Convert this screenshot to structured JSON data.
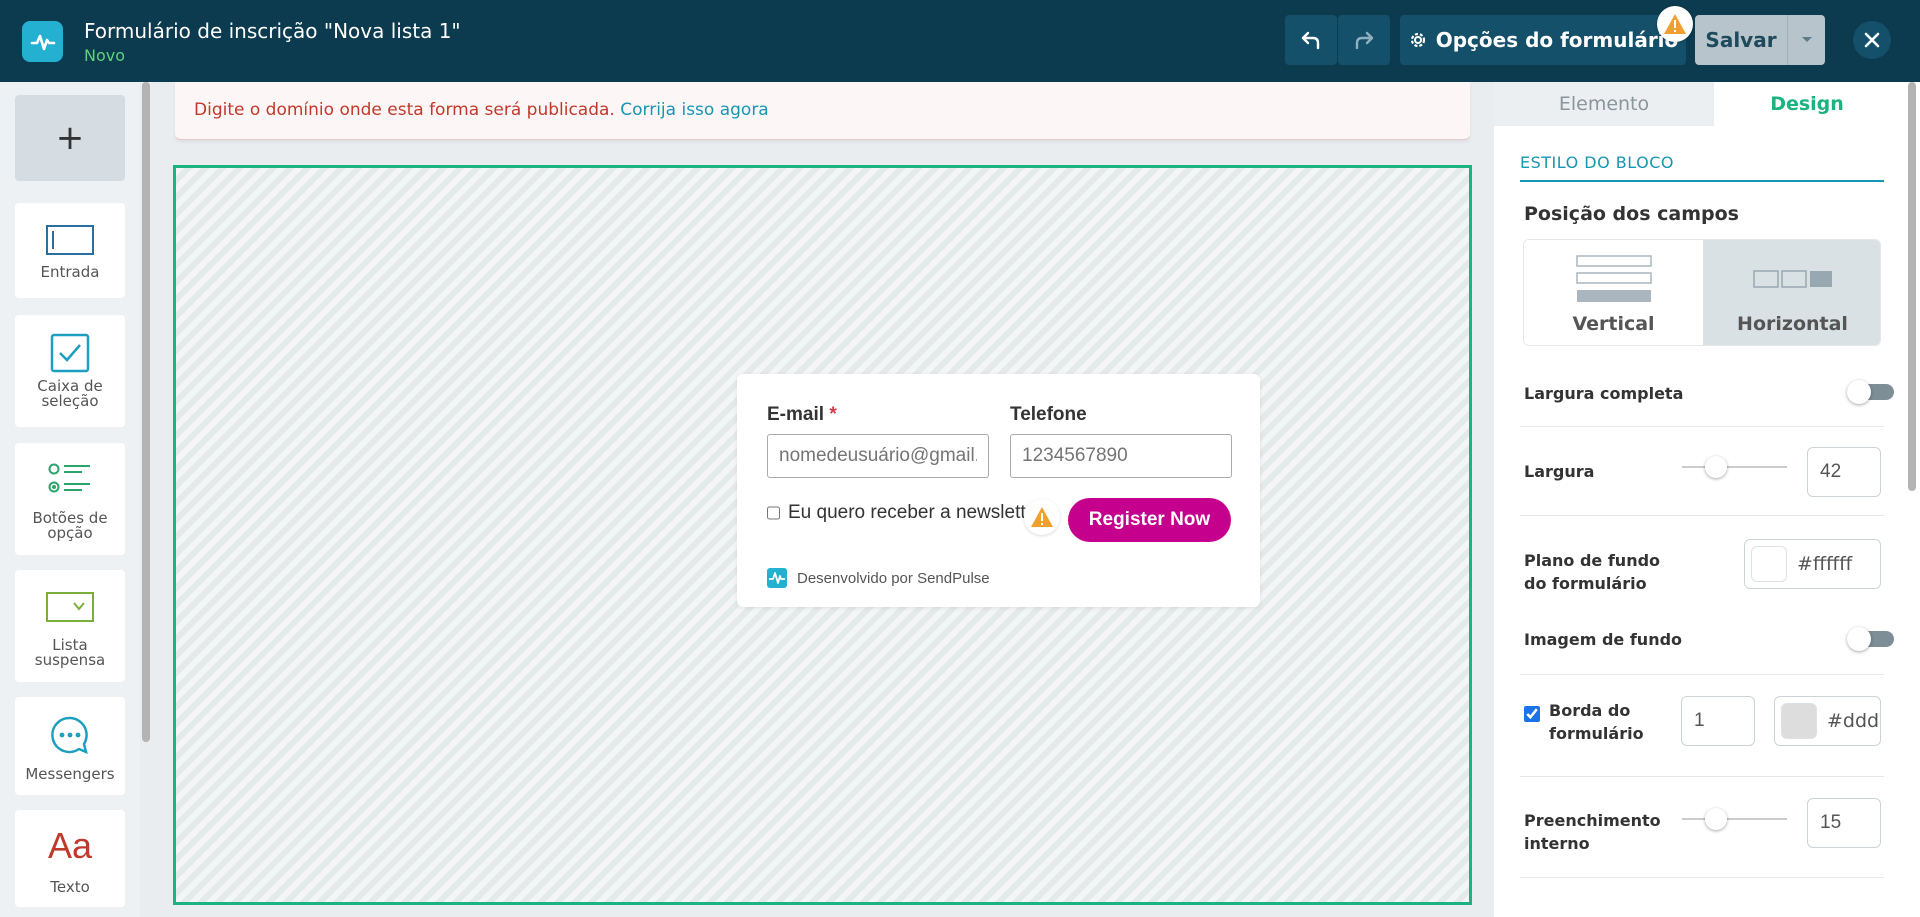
{
  "header": {
    "title": "Formulário de inscrição \"Nova lista 1\"",
    "status": "Novo",
    "options_label": "Opções do formulário",
    "save_label": "Salvar"
  },
  "palette": {
    "items": [
      {
        "label": "Entrada"
      },
      {
        "label": "Caixa de seleção"
      },
      {
        "label": "Botões de opção"
      },
      {
        "label": "Lista suspensa"
      },
      {
        "label": "Messengers"
      },
      {
        "label": "Texto"
      }
    ]
  },
  "alert": {
    "text": "Digite o domínio onde esta forma será publicada.",
    "link": "Corrija isso agora"
  },
  "form": {
    "email_label": "E-mail",
    "email_required_mark": "*",
    "email_placeholder": "nomedeusuário@gmail.com",
    "phone_label": "Telefone",
    "phone_placeholder": "1234567890",
    "checkbox_label": "Eu quero receber a newsletter",
    "submit_label": "Register Now",
    "powered_by": "Desenvolvido por SendPulse"
  },
  "panel": {
    "tabs": [
      {
        "label": "Elemento",
        "active": false
      },
      {
        "label": "Design",
        "active": true
      }
    ],
    "section_title": "ESTILO DO BLOCO",
    "field_position_heading": "Posição dos campos",
    "layout_options": [
      {
        "label": "Vertical",
        "selected": false
      },
      {
        "label": "Horizontal",
        "selected": true
      }
    ],
    "full_width_label": "Largura completa",
    "full_width_on": false,
    "width_label": "Largura",
    "width_value": "42",
    "bg_label": "Plano de fundo do formulário",
    "bg_color": "#ffffff",
    "bg_image_label": "Imagem de fundo",
    "bg_image_on": false,
    "border_label": "Borda do formulário",
    "border_checked": true,
    "border_width": "1",
    "border_color": "#ddd",
    "padding_label": "Preenchimento interno",
    "padding_value": "15"
  },
  "colors": {
    "topbar": "#0c3a4f",
    "accent_green": "#1bb37f",
    "accent_blue": "#1796b3",
    "submit_button": "#c5008c",
    "warning": "#f0a030"
  }
}
